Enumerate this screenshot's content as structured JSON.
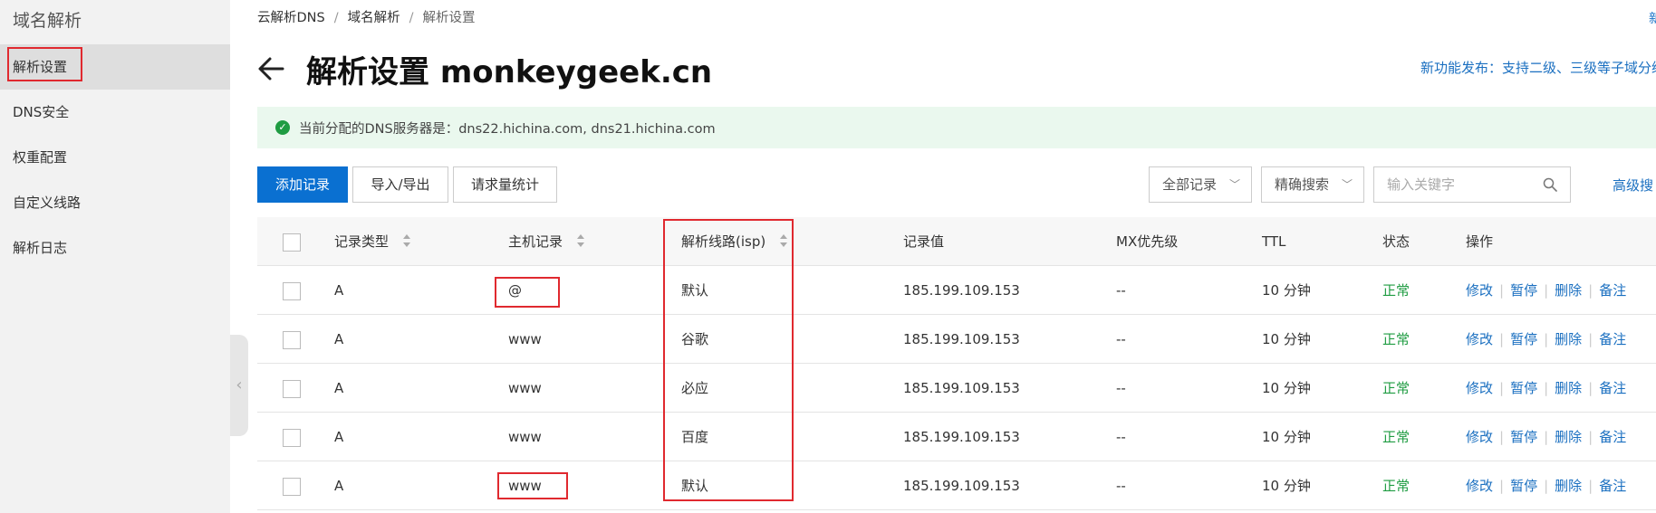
{
  "sidebar": {
    "title": "域名解析",
    "items": [
      {
        "label": "解析设置"
      },
      {
        "label": "DNS安全"
      },
      {
        "label": "权重配置"
      },
      {
        "label": "自定义线路"
      },
      {
        "label": "解析日志"
      }
    ],
    "collapse_glyph": "‹"
  },
  "breadcrumb": [
    "云解析DNS",
    "域名解析",
    "解析设置"
  ],
  "breadcrumb_sep": "/",
  "top_right_link": "新",
  "page_title": "解析设置 monkeygeek.cn",
  "announcement": "新功能发布：支持二级、三级等子域分级管理",
  "dns_notice": "当前分配的DNS服务器是：dns22.hichina.com, dns21.hichina.com",
  "toolbar": {
    "add_record": "添加记录",
    "import_export": "导入/导出",
    "request_stats": "请求量统计",
    "filter_all": "全部记录",
    "search_mode": "精确搜索",
    "search_placeholder": "输入关键字",
    "advanced_search": "高级搜"
  },
  "table": {
    "headers": {
      "type": "记录类型",
      "host": "主机记录",
      "line": "解析线路(isp)",
      "value": "记录值",
      "mx": "MX优先级",
      "ttl": "TTL",
      "status": "状态",
      "actions": "操作"
    },
    "action_labels": [
      "修改",
      "暂停",
      "删除",
      "备注"
    ],
    "rows": [
      {
        "type": "A",
        "host": "@",
        "line": "默认",
        "value": "185.199.109.153",
        "mx": "--",
        "ttl": "10 分钟",
        "status": "正常"
      },
      {
        "type": "A",
        "host": "www",
        "line": "谷歌",
        "value": "185.199.109.153",
        "mx": "--",
        "ttl": "10 分钟",
        "status": "正常"
      },
      {
        "type": "A",
        "host": "www",
        "line": "必应",
        "value": "185.199.109.153",
        "mx": "--",
        "ttl": "10 分钟",
        "status": "正常"
      },
      {
        "type": "A",
        "host": "www",
        "line": "百度",
        "value": "185.199.109.153",
        "mx": "--",
        "ttl": "10 分钟",
        "status": "正常"
      },
      {
        "type": "A",
        "host": "www",
        "line": "默认",
        "value": "185.199.109.153",
        "mx": "--",
        "ttl": "10 分钟",
        "status": "正常"
      }
    ]
  },
  "colors": {
    "primary": "#0a70d1",
    "link": "#1a6fc0",
    "success": "#1f9c42",
    "highlight": "#e0292f"
  }
}
